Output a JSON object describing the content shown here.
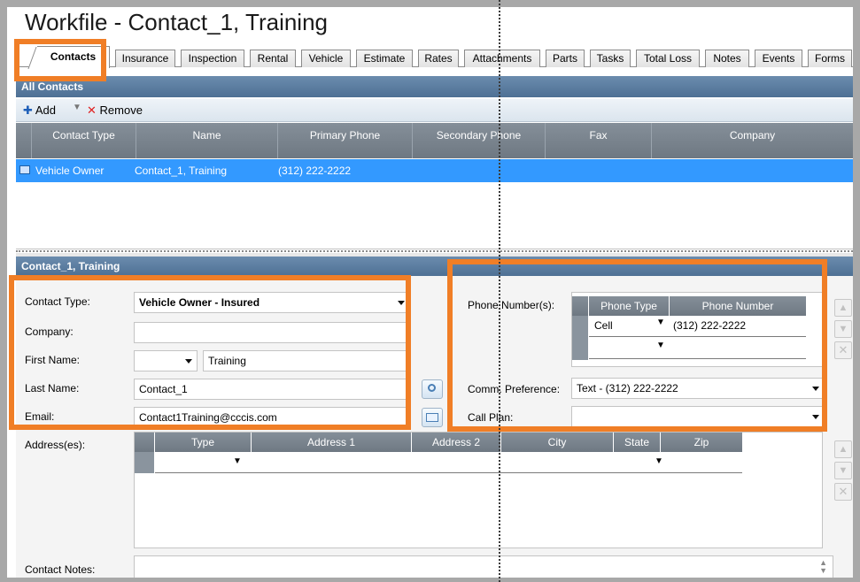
{
  "window": {
    "title": "Workfile - Contact_1, Training"
  },
  "tabs": [
    "Contacts",
    "Insurance",
    "Inspection",
    "Rental",
    "Vehicle",
    "Estimate",
    "Rates",
    "Attachments",
    "Parts",
    "Tasks",
    "Total Loss",
    "Notes",
    "Events",
    "Forms"
  ],
  "all_contacts": {
    "header": "All Contacts",
    "toolbar": {
      "add_label": "Add",
      "remove_label": "Remove"
    },
    "columns": [
      "Contact Type",
      "Name",
      "Primary Phone",
      "Secondary Phone",
      "Fax",
      "Company"
    ],
    "rows": [
      {
        "contact_type": "Vehicle Owner",
        "name": "Contact_1, Training",
        "primary_phone": "(312) 222-2222",
        "secondary_phone": "",
        "fax": "",
        "company": ""
      }
    ]
  },
  "detail": {
    "header": "Contact_1, Training",
    "contact_type_label": "Contact Type:",
    "contact_type_value": "Vehicle Owner - Insured",
    "company_label": "Company:",
    "company_value": "",
    "first_name_label": "First Name:",
    "first_name_prefix": "",
    "first_name_value": "Training",
    "last_name_label": "Last Name:",
    "last_name_value": "Contact_1",
    "email_label": "Email:",
    "email_value": "Contact1Training@cccis.com",
    "phone_numbers_label": "Phone Number(s):",
    "phone_columns": [
      "Phone Type",
      "Phone Number"
    ],
    "phones": [
      {
        "type": "Cell",
        "number": "(312) 222-2222"
      },
      {
        "type": "",
        "number": ""
      }
    ],
    "comm_pref_label": "Comm. Preference:",
    "comm_pref_value": "Text - (312) 222-2222",
    "call_plan_label": "Call Plan:",
    "call_plan_value": "",
    "addresses_label": "Address(es):",
    "address_columns": [
      "Type",
      "Address 1",
      "Address 2",
      "City",
      "State",
      "Zip"
    ],
    "contact_notes_label": "Contact Notes:",
    "contact_notes_value": ""
  },
  "colors": {
    "highlight": "#f07e26",
    "selection": "#3399ff",
    "section_header": "#5a7ca0"
  },
  "icons": [
    "add-icon",
    "dropdown-icon",
    "remove-icon",
    "contact-card-icon",
    "search-icon",
    "email-icon",
    "move-up-icon",
    "move-down-icon",
    "delete-icon"
  ]
}
